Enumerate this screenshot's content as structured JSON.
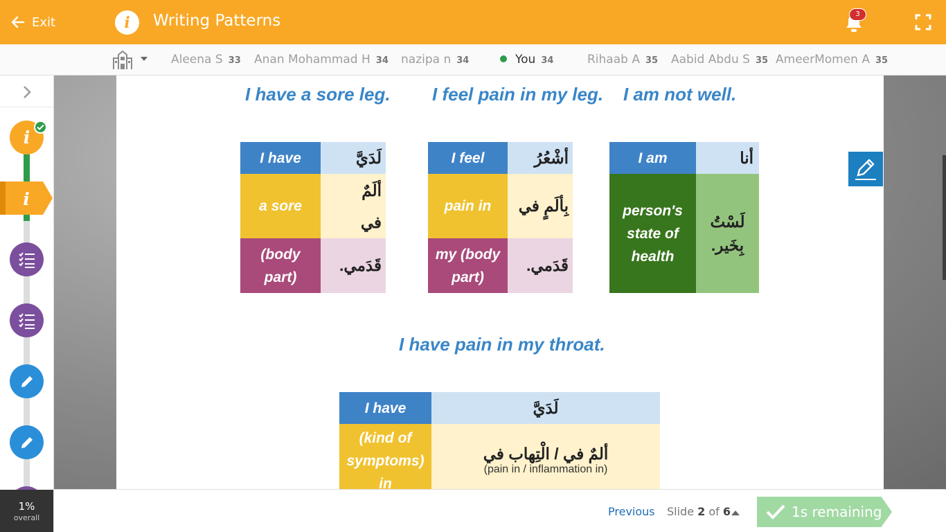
{
  "header": {
    "exit_label": "Exit",
    "title": "Writing Patterns",
    "notification_count": "3",
    "accent": "#f9a825"
  },
  "leaderboard": {
    "entries": [
      {
        "name": "Aleena S",
        "points": "33"
      },
      {
        "name": "Anan Mohammad H",
        "points": "34"
      },
      {
        "name": "nazipa n",
        "points": "34"
      },
      {
        "name": "You",
        "points": "34"
      },
      {
        "name": "Rihaab A",
        "points": "35"
      },
      {
        "name": "Aabid Abdu S",
        "points": "35"
      },
      {
        "name": "AmeerMomen A",
        "points": "35"
      }
    ]
  },
  "sidebar": {
    "nodes": [
      {
        "type": "info",
        "glyph": "i",
        "icon": "info-icon",
        "status": "complete"
      },
      {
        "type": "info",
        "glyph": "i",
        "icon": "info-icon",
        "status": "active"
      },
      {
        "type": "checklist",
        "icon": "checklist-icon"
      },
      {
        "type": "checklist",
        "icon": "checklist-icon"
      },
      {
        "type": "writing",
        "icon": "pencil-icon"
      },
      {
        "type": "writing",
        "icon": "pencil-icon"
      }
    ],
    "progress_value": "1%",
    "progress_label": "overall"
  },
  "slide": {
    "patterns": [
      {
        "caption": "I have a sore leg.",
        "rows": [
          {
            "en": "I have",
            "ar": "لَدَيَّ"
          },
          {
            "en": "a sore",
            "ar": "ألَمٌ\nفي"
          },
          {
            "en": "(body part)",
            "ar": "قَدَمي."
          }
        ]
      },
      {
        "caption": "I feel pain in my leg.",
        "rows": [
          {
            "en": "I feel",
            "ar": "أشْعُرُ"
          },
          {
            "en": "pain in",
            "ar": "بِألَمٍ في"
          },
          {
            "en": "my (body part)",
            "ar": "قَدَمي."
          }
        ]
      },
      {
        "caption": "I am not well.",
        "rows": [
          {
            "en": "I am",
            "ar": "أنا"
          },
          {
            "en": "person's state of health",
            "ar": "لَسْتُ بِخَير."
          }
        ]
      },
      {
        "caption": "I have pain in my throat.",
        "rows": [
          {
            "en": "I have",
            "ar": "لَدَيَّ"
          },
          {
            "en": "(kind of symptoms) in",
            "ar": "ألمٌ في / الْتِهاب في",
            "ar_sub": "(pain in / inflammation in)"
          }
        ]
      }
    ]
  },
  "footer": {
    "previous_label": "Previous",
    "slide_prefix": "Slide",
    "slide_current": "2",
    "slide_of": "of",
    "slide_total": "6",
    "remaining_label": "1s remaining",
    "remaining_color": "#a1d9a3"
  }
}
